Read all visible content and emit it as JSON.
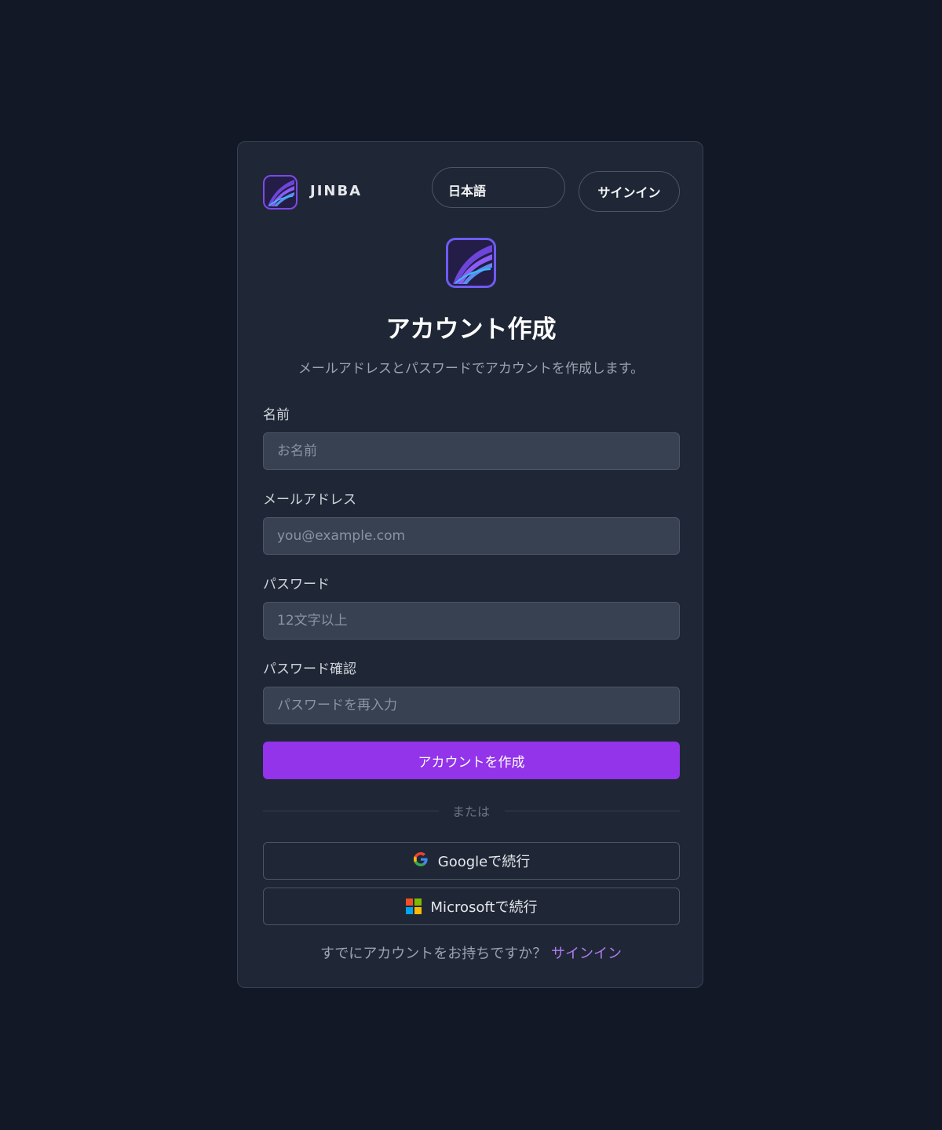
{
  "brand": {
    "name": "JINBA",
    "icon": "jinba-logo-icon"
  },
  "header": {
    "language": "日本語",
    "signin_label": "サインイン"
  },
  "title": "アカウント作成",
  "subtitle": "メールアドレスとパスワードでアカウントを作成します。",
  "form": {
    "name": {
      "label": "名前",
      "placeholder": "お名前",
      "value": ""
    },
    "email": {
      "label": "メールアドレス",
      "placeholder": "you@example.com",
      "value": ""
    },
    "password": {
      "label": "パスワード",
      "placeholder": "12文字以上",
      "value": ""
    },
    "confirm": {
      "label": "パスワード確認",
      "placeholder": "パスワードを再入力",
      "value": ""
    },
    "submit_label": "アカウントを作成"
  },
  "divider": "または",
  "oauth": {
    "google_label": "Googleで続行",
    "google_icon": "google-icon",
    "microsoft_label": "Microsoftで続行",
    "microsoft_icon": "microsoft-icon"
  },
  "footer": {
    "text": "すでにアカウントをお持ちですか？",
    "link": "サインイン"
  },
  "colors": {
    "background": "#121826",
    "card": "#1f2736",
    "accent": "#9333ea",
    "link": "#b07cf0"
  }
}
